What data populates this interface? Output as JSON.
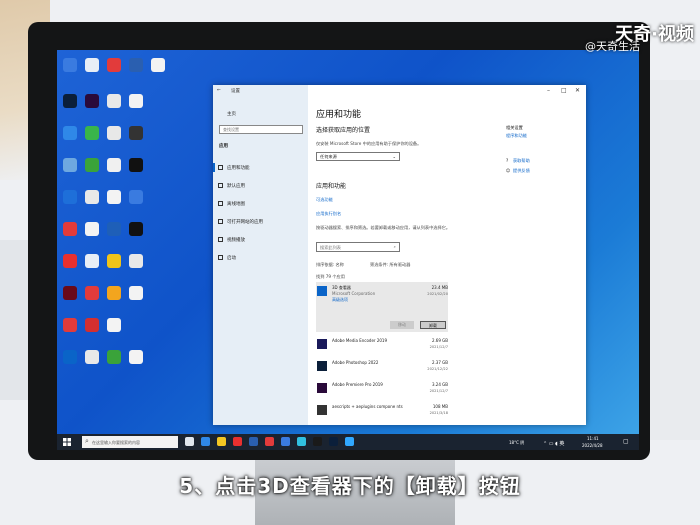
{
  "watermark": {
    "brand": "天奇·视频",
    "sub": "@天奇生活"
  },
  "caption": "5、点击3D查看器下的【卸载】按钮",
  "desktop": {
    "icons": [
      {
        "color": "#3a7be0"
      },
      {
        "color": "#e8eef6"
      },
      {
        "color": "#e23b3b"
      },
      {
        "color": "#2a5fb0"
      },
      {
        "color": "#f3f3f3"
      },
      {
        "color": "#0b1f3a"
      },
      {
        "color": "#2a0a3a"
      },
      {
        "color": "#e8e8e8"
      },
      {
        "color": "#f3f3f3"
      },
      {
        "color": "#2f88e8"
      },
      {
        "color": "#39b54a"
      },
      {
        "color": "#e8e8e8"
      },
      {
        "color": "#333"
      },
      {
        "color": "#6ea8e0"
      },
      {
        "color": "#3aa33a"
      },
      {
        "color": "#f0f0f0"
      },
      {
        "color": "#111"
      },
      {
        "color": "#1e6fd9"
      },
      {
        "color": "#e8e8e8"
      },
      {
        "color": "#f3f3f3"
      },
      {
        "color": "#3a7be0"
      },
      {
        "color": "#e23b3b"
      },
      {
        "color": "#f3f3f3"
      },
      {
        "color": "#1e5fb8"
      },
      {
        "color": "#111"
      },
      {
        "color": "#e8302f"
      },
      {
        "color": "#e8eef6"
      },
      {
        "color": "#f0c419"
      },
      {
        "color": "#e8e8e8"
      },
      {
        "color": "#6a0a1a"
      },
      {
        "color": "#e23b3b"
      },
      {
        "color": "#f3a51e"
      },
      {
        "color": "#f3f3f3"
      },
      {
        "color": "#e23b3b"
      },
      {
        "color": "#d32f2f"
      },
      {
        "color": "#f3f3f3"
      },
      {
        "color": "#0a64c8"
      },
      {
        "color": "#e8e8e8"
      },
      {
        "color": "#3aa33a"
      },
      {
        "color": "#f3f3f3"
      }
    ]
  },
  "window": {
    "back": "←",
    "title": "设置",
    "controls": [
      "–",
      "□",
      "✕"
    ],
    "sidebar": {
      "home": "主页",
      "search_placeholder": "查找设置",
      "section": "应用",
      "items": [
        {
          "label": "应用和功能"
        },
        {
          "label": "默认应用"
        },
        {
          "label": "离线地图"
        },
        {
          "label": "可打开网站的应用"
        },
        {
          "label": "视频播放"
        },
        {
          "label": "启动"
        }
      ]
    },
    "main": {
      "title": "应用和功能",
      "subtitle": "选择获取应用的位置",
      "desc": "仅安装 Microsoft Store 中的应用有助于保护你的设备。",
      "source_value": "任何来源",
      "section2": "应用和功能",
      "link1": "可选功能",
      "link2": "应用执行别名",
      "search_desc": "按驱动器搜索、排序和筛选。若要卸载或移动应用，请从列表中选择它。",
      "search_placeholder": "搜索此列表",
      "sort_label": "排序依据: 名称",
      "filter_label": "筛选条件: 所有驱动器",
      "count": "找到 79 个应用",
      "apps": [
        {
          "name": "3D 查看器",
          "publisher": "Microsoft Corporation",
          "adv": "高级选项",
          "size": "23.4 MB",
          "date": "2021/02/20",
          "color": "#0a64c8"
        },
        {
          "name": "Adobe Media Encoder 2019",
          "size": "2.69 GB",
          "date": "2021/12/7",
          "color": "#1a1a5a"
        },
        {
          "name": "Adobe Photoshop 2022",
          "size": "2.37 GB",
          "date": "2021/12/22",
          "color": "#0b1f3a"
        },
        {
          "name": "Adobe Premiere Pro 2019",
          "size": "3.24 GB",
          "date": "2021/12/7",
          "color": "#2a0a3a"
        },
        {
          "name": "aescripts + aeplugins compone nts",
          "size": "108 MB",
          "date": "2021/3/18",
          "color": "#333"
        }
      ],
      "move_btn": "移动",
      "uninstall_btn": "卸载"
    },
    "right_panel": {
      "section": "相关设置",
      "link": "程序和功能",
      "help": "获取帮助",
      "feedback": "提供反馈"
    }
  },
  "taskbar": {
    "search_placeholder": "在这里输入你要搜索的内容",
    "weather": "18°C 阴",
    "time": "11:41",
    "date": "2022/4/28",
    "icons": [
      {
        "color": "#dfe6ee"
      },
      {
        "color": "#2f88e8"
      },
      {
        "color": "#f3c623"
      },
      {
        "color": "#e8302f"
      },
      {
        "color": "#2a5fb0"
      },
      {
        "color": "#e23b3b"
      },
      {
        "color": "#3a7be0"
      },
      {
        "color": "#31c0e0"
      },
      {
        "color": "#1a1a1a"
      },
      {
        "color": "#0b1f3a"
      },
      {
        "color": "#31a8ff"
      }
    ]
  }
}
